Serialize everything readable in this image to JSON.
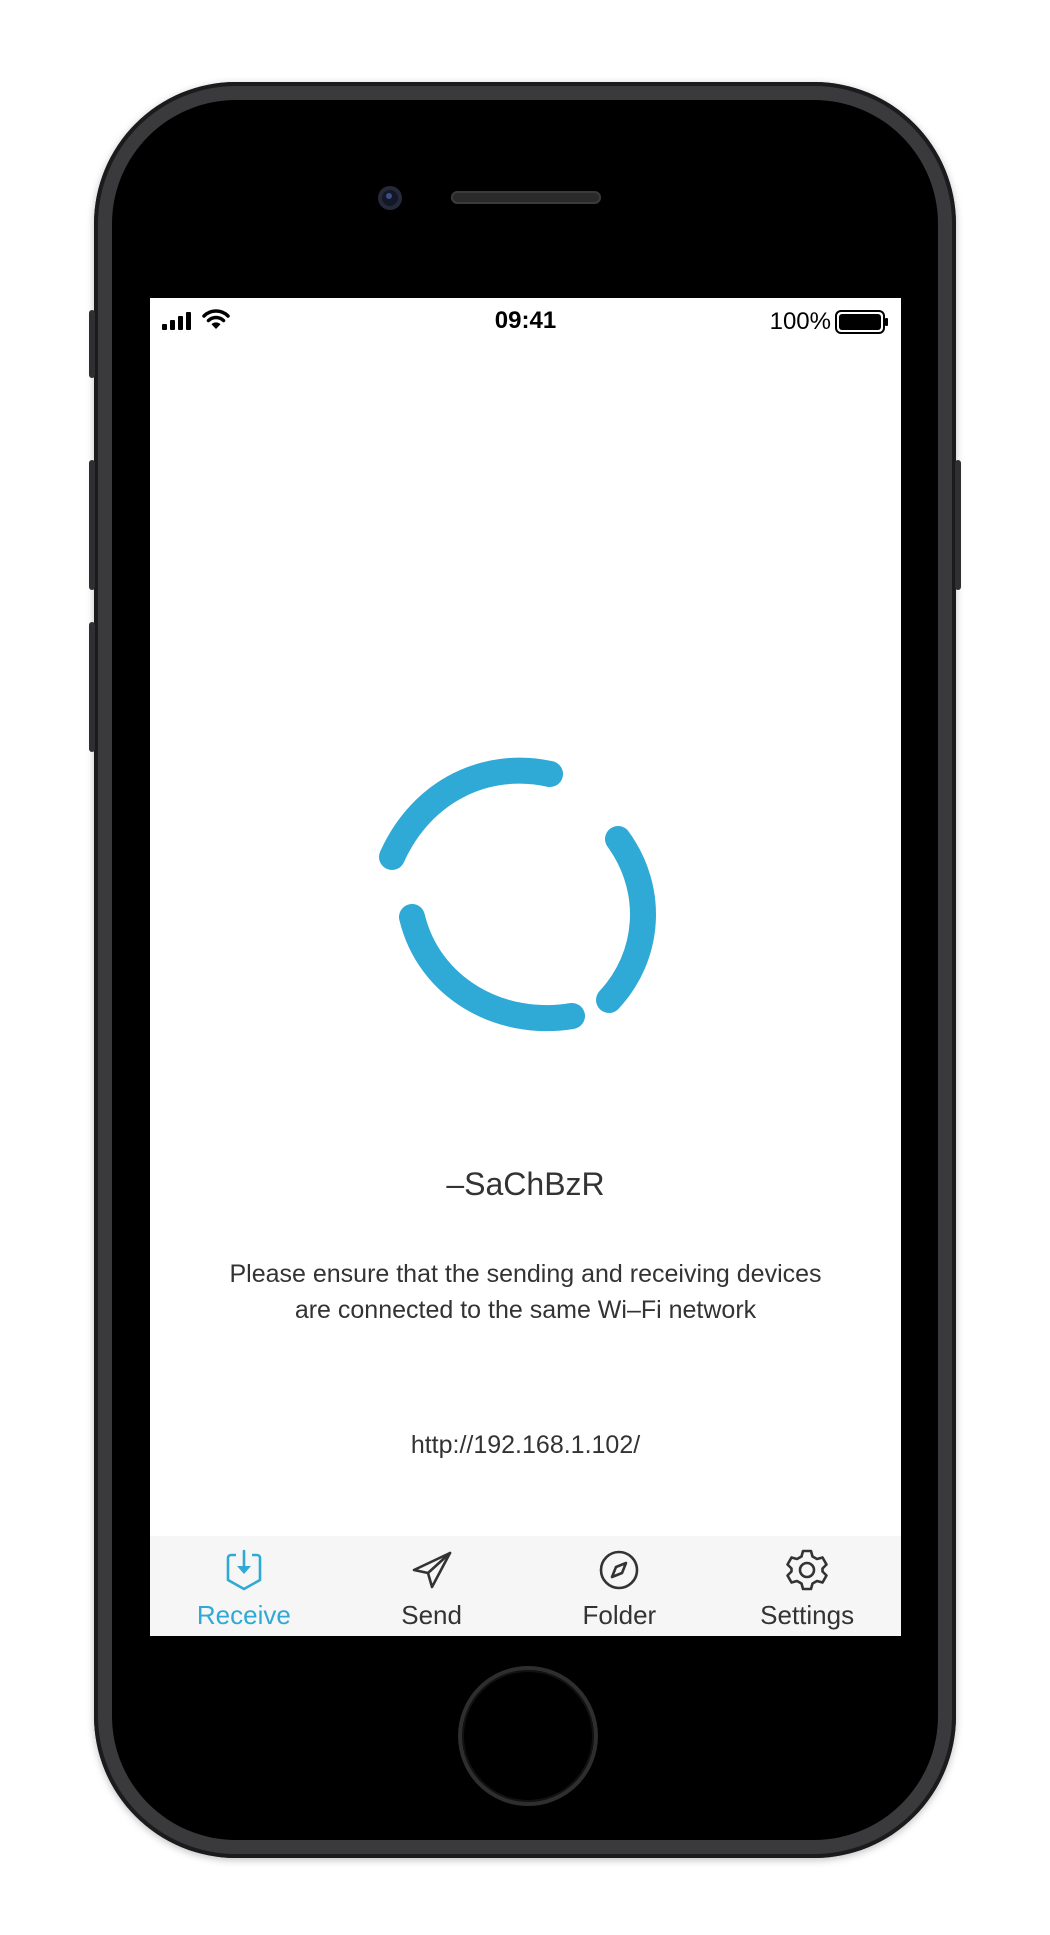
{
  "status_bar": {
    "time": "09:41",
    "battery_percent": "100%",
    "signal_icon": "cellular-signal-icon",
    "wifi_icon": "wifi-icon",
    "battery_icon": "battery-full-icon",
    "battery_level": 1.0
  },
  "receive": {
    "spinner_icon": "loading-spinner-icon",
    "device_name": "–SaChBzR",
    "instructions_line1": "Please ensure that the sending and receiving devices",
    "instructions_line2": "are connected to the same Wi–Fi network",
    "server_url": "http://192.168.1.102/"
  },
  "tab_bar": {
    "tabs": [
      {
        "label": "Receive",
        "icon": "download-box-icon",
        "active": true
      },
      {
        "label": "Send",
        "icon": "paper-plane-icon",
        "active": false
      },
      {
        "label": "Folder",
        "icon": "compass-icon",
        "active": false
      },
      {
        "label": "Settings",
        "icon": "gear-icon",
        "active": false
      }
    ]
  },
  "colors": {
    "accent": "#2fa9d5",
    "text": "#333333",
    "tab_bar_background": "#f6f6f6"
  }
}
